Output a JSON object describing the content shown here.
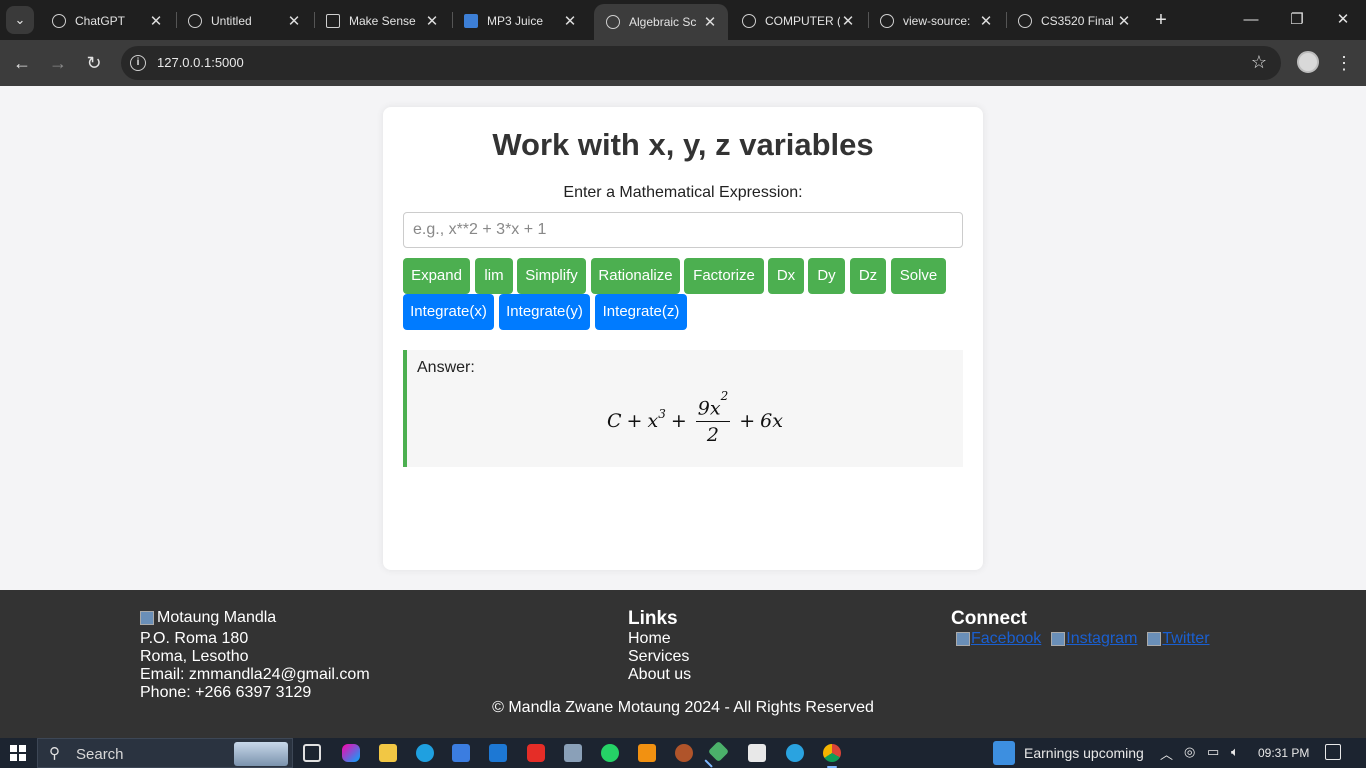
{
  "browser": {
    "tabs": [
      {
        "title": "ChatGPT",
        "icon": "chatgpt-icon",
        "active": false
      },
      {
        "title": "Untitled",
        "icon": "globe-icon",
        "active": false
      },
      {
        "title": "Make Sense",
        "icon": "frame-icon",
        "active": false
      },
      {
        "title": "MP3 Juice",
        "icon": "download-icon",
        "active": false
      },
      {
        "title": "Algebraic Sc",
        "icon": "globe-icon",
        "active": true
      },
      {
        "title": "COMPUTER (",
        "icon": "globe-icon",
        "active": false
      },
      {
        "title": "view-source:",
        "icon": "globe-icon",
        "active": false
      },
      {
        "title": "CS3520 Final",
        "icon": "globe-icon",
        "active": false
      }
    ],
    "close_glyph": "✕",
    "new_tab_glyph": "+",
    "url": "127.0.0.1:5000"
  },
  "page": {
    "heading": "Work with x, y, z variables",
    "prompt": "Enter a Mathematical Expression:",
    "input": {
      "placeholder": "e.g., x**2 + 3*x + 1",
      "value": ""
    },
    "buttons_green": [
      "Expand",
      "lim",
      "Simplify",
      "Rationalize",
      "Factorize",
      "Dx",
      "Dy",
      "Dz",
      "Solve"
    ],
    "buttons_blue": [
      "Integrate(x)",
      "Integrate(y)",
      "Integrate(z)"
    ],
    "answer_label": "Answer:",
    "answer_math": {
      "t1": "C",
      "t2": "x",
      "exp": "3",
      "num": "9x",
      "num_exp": "2",
      "den": "2",
      "t4": "6x",
      "plus": "+"
    },
    "colors": {
      "green": "#4caf50",
      "blue": "#007bff"
    }
  },
  "footer": {
    "logo_alt": "Motaung Mandla",
    "address1": "P.O. Roma 180",
    "address2": "Roma, Lesotho",
    "email": "Email: zmmandla24@gmail.com",
    "phone": "Phone: +266 6397 3129",
    "links_heading": "Links",
    "links": [
      "Home",
      "Services",
      "About us"
    ],
    "connect_heading": "Connect",
    "social": [
      "Facebook",
      "Instagram",
      "Twitter"
    ],
    "copyright": "© Mandla Zwane Motaung 2024 - All Rights Reserved"
  },
  "taskbar": {
    "search_label": "Search",
    "weather_text": "Earnings upcoming",
    "time": "09:31 PM"
  }
}
